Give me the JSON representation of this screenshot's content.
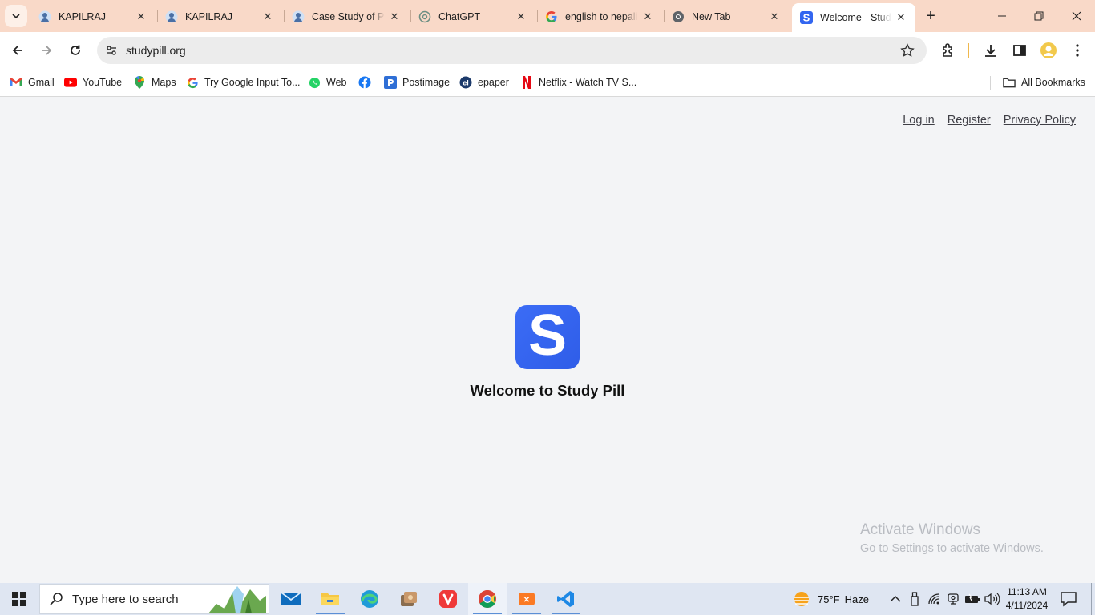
{
  "browser": {
    "tabs": [
      {
        "title": "KAPILRAJ",
        "icon": "profile-icon"
      },
      {
        "title": "KAPILRAJ",
        "icon": "profile-icon"
      },
      {
        "title": "Case Study of Pr",
        "icon": "profile-icon"
      },
      {
        "title": "ChatGPT",
        "icon": "chatgpt-icon"
      },
      {
        "title": "english to nepali",
        "icon": "google-icon"
      },
      {
        "title": "New Tab",
        "icon": "chrome-icon"
      },
      {
        "title": "Welcome - Study",
        "icon": "studypill-icon",
        "active": true
      }
    ],
    "url": "studypill.org",
    "bookmarks": [
      {
        "label": "Gmail",
        "icon": "gmail-icon"
      },
      {
        "label": "YouTube",
        "icon": "youtube-icon"
      },
      {
        "label": "Maps",
        "icon": "maps-icon"
      },
      {
        "label": "Try Google Input To...",
        "icon": "google-icon"
      },
      {
        "label": "Web",
        "icon": "whatsapp-icon"
      },
      {
        "label": "",
        "icon": "facebook-icon"
      },
      {
        "label": "Postimage",
        "icon": "postimage-icon"
      },
      {
        "label": "epaper",
        "icon": "epaper-icon"
      },
      {
        "label": "Netflix - Watch TV S...",
        "icon": "netflix-icon"
      }
    ],
    "all_bookmarks_label": "All Bookmarks"
  },
  "page": {
    "nav_links": {
      "login": "Log in",
      "register": "Register",
      "privacy": "Privacy Policy"
    },
    "logo_letter": "S",
    "heading": "Welcome to Study Pill",
    "watermark": {
      "title": "Activate Windows",
      "subtitle": "Go to Settings to activate Windows."
    }
  },
  "taskbar": {
    "search_placeholder": "Type here to search",
    "weather": {
      "temp": "75°F",
      "condition": "Haze"
    },
    "time": "11:13 AM",
    "date": "4/11/2024"
  },
  "colors": {
    "brand": "#3366f0",
    "tab_strip": "#f9d9c8",
    "page_bg": "#f3f4f6"
  }
}
